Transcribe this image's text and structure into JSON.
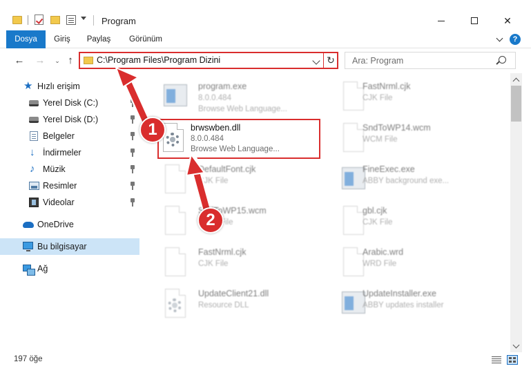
{
  "titlebar": {
    "title": "Program",
    "min_glyph": "",
    "close_glyph": "✕"
  },
  "ribbon": {
    "tabs": [
      "Dosya",
      "Giriş",
      "Paylaş",
      "Görünüm"
    ],
    "help": "?"
  },
  "nav": {
    "back": "←",
    "forward": "→",
    "recent": "⌄",
    "up": "↑",
    "address_path": "C:\\Program Files\\Program Dizini",
    "refresh": "↻",
    "search_placeholder": "Ara: Program"
  },
  "sidebar": {
    "items": [
      {
        "label": "Hızlı erişim",
        "icon": "star-icon"
      },
      {
        "label": "Yerel Disk (C:)",
        "icon": "drive-icon"
      },
      {
        "label": "Yerel Disk (D:)",
        "icon": "drive-icon"
      },
      {
        "label": "Belgeler",
        "icon": "documents-icon"
      },
      {
        "label": "İndirmeler",
        "icon": "download-icon"
      },
      {
        "label": "Müzik",
        "icon": "music-icon"
      },
      {
        "label": "Resimler",
        "icon": "pictures-icon"
      },
      {
        "label": "Videolar",
        "icon": "video-icon"
      },
      {
        "label": "OneDrive",
        "icon": "cloud-icon"
      },
      {
        "label": "Bu bilgisayar",
        "icon": "computer-icon"
      },
      {
        "label": "Ağ",
        "icon": "network-icon"
      }
    ]
  },
  "files": {
    "program": {
      "name": "program.exe",
      "meta": "8.0.0.484",
      "desc": "Browse Web Language..."
    },
    "target": {
      "name": "brwswben.dll",
      "meta": "8.0.0.484",
      "desc": "Browse Web Language..."
    },
    "defaultfont": {
      "name": "DefaultFont.cjk",
      "meta": "CJK File"
    },
    "sndtowp": {
      "name": "SndToWP15.wcm",
      "meta": "WCM File"
    },
    "fastnrml1": {
      "name": "FastNrml.cjk",
      "meta": "CJK File"
    },
    "updateclient": {
      "name": "UpdateClient21.dll",
      "meta": "Resource DLL"
    },
    "fastnrml2": {
      "name": "FastNrml.cjk",
      "meta": "CJK File"
    },
    "sndtowp14": {
      "name": "SndToWP14.wcm",
      "meta": "WCM File"
    },
    "fineexec": {
      "name": "FineExec.exe",
      "meta": "ABBY background exe..."
    },
    "gbl": {
      "name": "gbl.cjk",
      "meta": "CJK File"
    },
    "arabic": {
      "name": "Arabic.wrd",
      "meta": "WRD File"
    },
    "updateinstaller": {
      "name": "UpdateInstaller.exe",
      "meta": "ABBY updates installer"
    }
  },
  "annotations": {
    "step1": "1",
    "step2": "2"
  },
  "status": {
    "count": "197 öğe"
  },
  "colors": {
    "accent": "#1979ca",
    "highlight": "#d92d2d",
    "selection": "#cce4f7"
  }
}
